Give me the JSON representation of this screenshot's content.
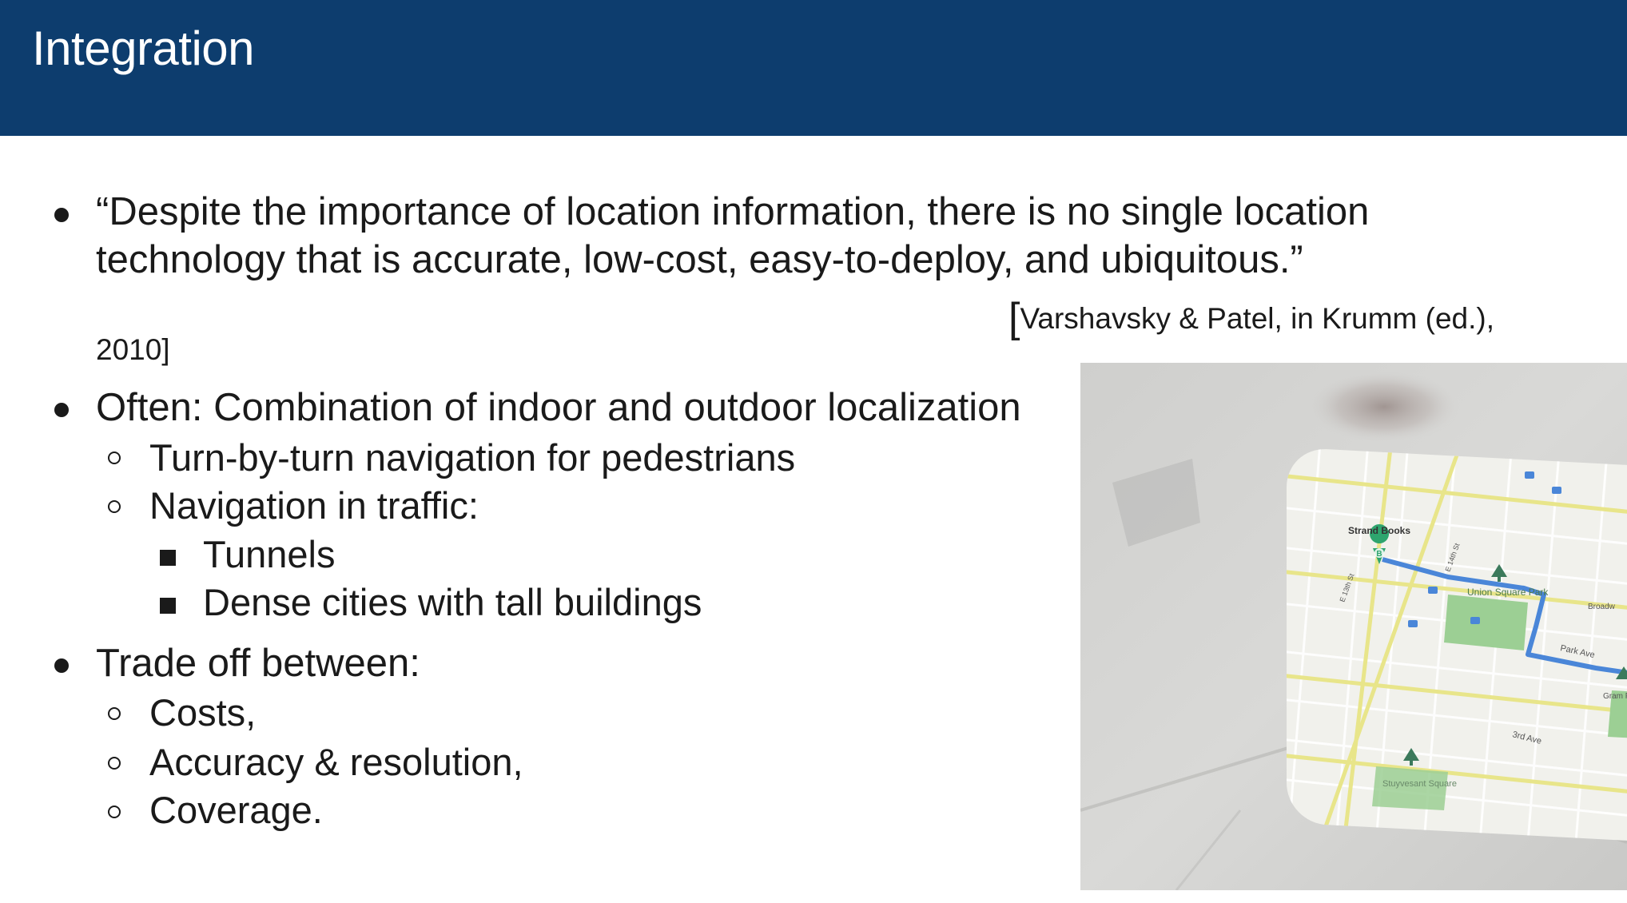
{
  "slide": {
    "title": "Integration",
    "quote": {
      "line1": "“Despite the importance of location information, there is no single location",
      "line2": "technology that is accurate, low-cost, easy-to-deploy, and ubiquitous.”",
      "citation_line1": "Varshavsky & Patel, in Krumm (ed.),",
      "citation_bracket": "[",
      "citation_line2": "2010]"
    },
    "bullets": [
      {
        "text": "Often: Combination of indoor and outdoor localization",
        "children": [
          {
            "text": "Turn-by-turn navigation for pedestrians"
          },
          {
            "text": "Navigation in traffic:",
            "children": [
              {
                "text": "Tunnels"
              },
              {
                "text": "Dense cities with tall buildings"
              }
            ]
          }
        ]
      },
      {
        "text": "Trade off between:",
        "children": [
          {
            "text": "Costs,"
          },
          {
            "text": "Accuracy & resolution,"
          },
          {
            "text": "Coverage."
          }
        ]
      }
    ]
  },
  "map_photo": {
    "labels": {
      "strand_books": "Strand Books",
      "union_square_park": "Union Square Park",
      "park_ave": "Park Ave",
      "third_ave": "3rd Ave",
      "stuyvesant_square": "Stuyvesant Square",
      "broadway": "Broadw",
      "e13th": "E 13th St",
      "e14th": "E 14th St",
      "gramercy": "Gram Pa",
      "marker_letter": "B"
    },
    "colors": {
      "route": "#4a86d8",
      "park": "#9ccf94",
      "street": "#e8e58a",
      "marker": "#2ea56e"
    }
  }
}
